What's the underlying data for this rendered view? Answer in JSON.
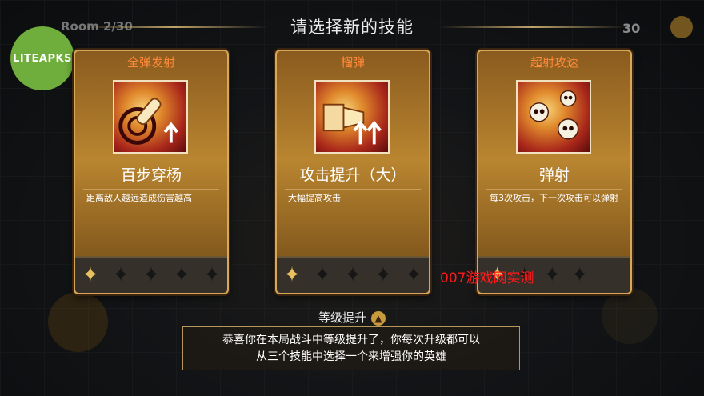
{
  "header": {
    "room": "Room 2/30",
    "coins": "30",
    "title": "请选择新的技能"
  },
  "logo": {
    "text": "LITEAPKS"
  },
  "cards": [
    {
      "category": "全弹发射",
      "name": "百步穿杨",
      "description": "距离敌人越远造成伤害越高",
      "icon": "bullet-target-icon",
      "stars_filled": 1,
      "stars_total": 5
    },
    {
      "category": "榴弹",
      "name": "攻击提升（大）",
      "description": "大幅提高攻击",
      "icon": "attack-up-icon",
      "stars_filled": 1,
      "stars_total": 5
    },
    {
      "category": "超射攻速",
      "name": "弹射",
      "description": "每3次攻击，下一次攻击可以弹射",
      "icon": "skulls-icon",
      "stars_filled": 1,
      "stars_total": 4
    }
  ],
  "watermark": "007游戏网实测",
  "level_up": {
    "title": "等级提升",
    "message_line1": "恭喜你在本局战斗中等级提升了，你每次升级都可以",
    "message_line2": "从三个技能中选择一个来增强你的英雄"
  },
  "colors": {
    "accent_orange": "#ff8a3a",
    "card_gold": "#b98530",
    "logo_green": "#6fad3c",
    "watermark_red": "#ff1a1a"
  }
}
